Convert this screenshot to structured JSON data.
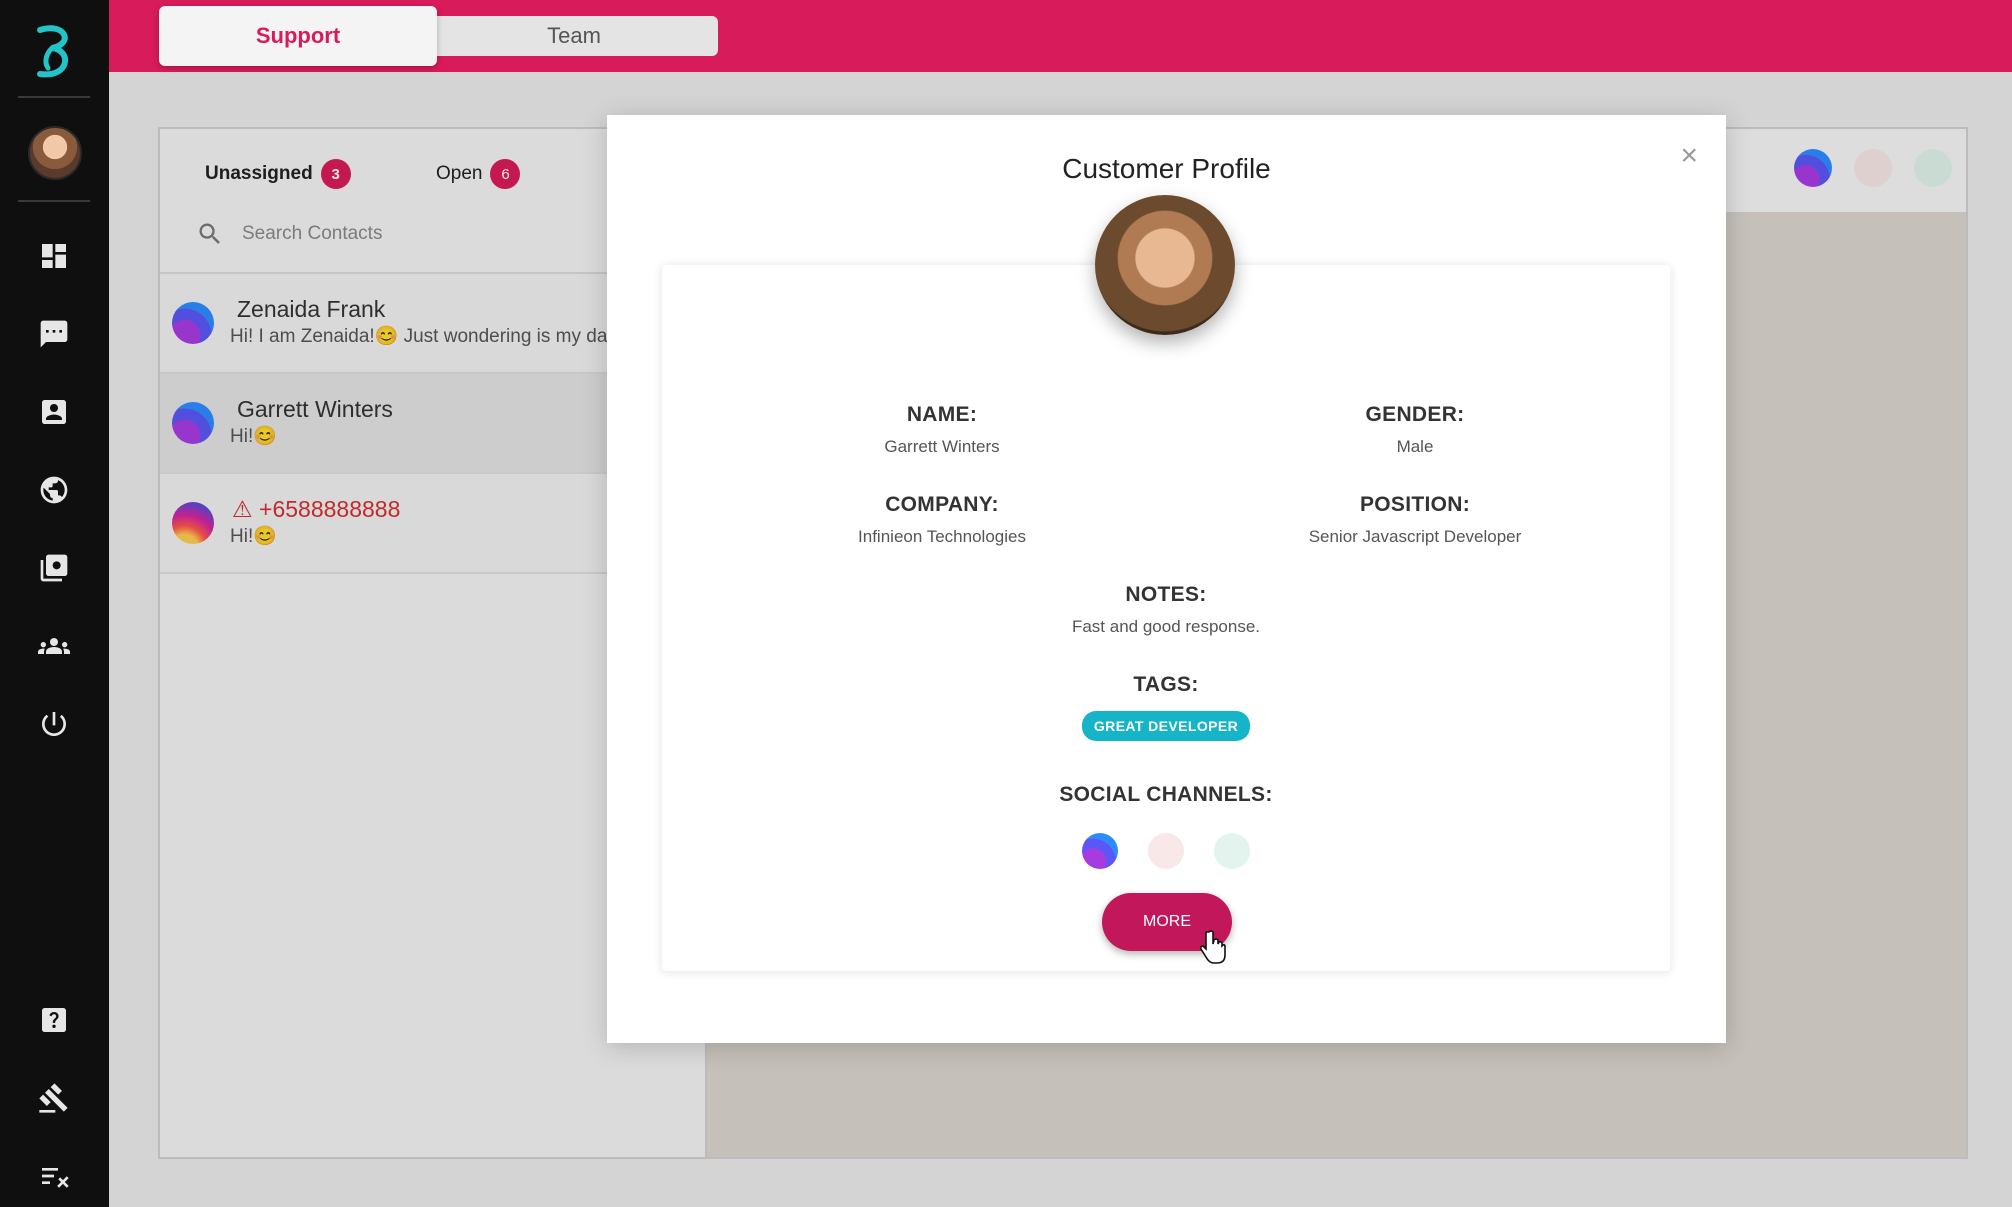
{
  "app": {
    "accent_color": "#d81b5a",
    "logo_icon": "beepboop-logo"
  },
  "topbar": {
    "tabs": [
      {
        "label": "Support",
        "active": true
      },
      {
        "label": "Team",
        "active": false
      }
    ]
  },
  "sidebar": {
    "items": [
      {
        "icon": "dashboard-icon"
      },
      {
        "icon": "chat-icon"
      },
      {
        "icon": "contacts-icon"
      },
      {
        "icon": "globe-icon"
      },
      {
        "icon": "media-icon"
      },
      {
        "icon": "team-icon"
      },
      {
        "icon": "power-icon"
      },
      {
        "icon": "help-icon"
      },
      {
        "icon": "tools-icon"
      },
      {
        "icon": "task-list-icon"
      }
    ]
  },
  "contacts": {
    "tabs": [
      {
        "label": "Unassigned",
        "count": "3"
      },
      {
        "label": "Open",
        "count": "6"
      }
    ],
    "search": {
      "placeholder": "Search Contacts"
    },
    "items": [
      {
        "name": "Zenaida Frank",
        "message": "Hi! I am Zenaida!😊 Just wondering is my da",
        "channel": "messenger"
      },
      {
        "name": "Garrett Winters",
        "message": "Hi!😊",
        "channel": "messenger"
      },
      {
        "name": "+6588888888",
        "message": "Hi!😊",
        "channel": "instagram",
        "warning": true
      }
    ]
  },
  "modal": {
    "title": "Customer Profile",
    "close": "×",
    "fields": {
      "name": {
        "label": "NAME:",
        "value": "Garrett Winters"
      },
      "gender": {
        "label": "GENDER:",
        "value": "Male"
      },
      "company": {
        "label": "COMPANY:",
        "value": "Infinieon Technologies"
      },
      "position": {
        "label": "POSITION:",
        "value": "Senior Javascript Developer"
      },
      "notes": {
        "label": "NOTES:",
        "value": "Fast and good response."
      },
      "tags": {
        "label": "TAGS:",
        "items": [
          "GREAT DEVELOPER"
        ]
      },
      "social": {
        "label": "SOCIAL CHANNELS:",
        "channels": [
          "messenger-icon",
          "instagram-icon",
          "whatsapp-icon"
        ]
      }
    },
    "more_button": "MORE"
  }
}
